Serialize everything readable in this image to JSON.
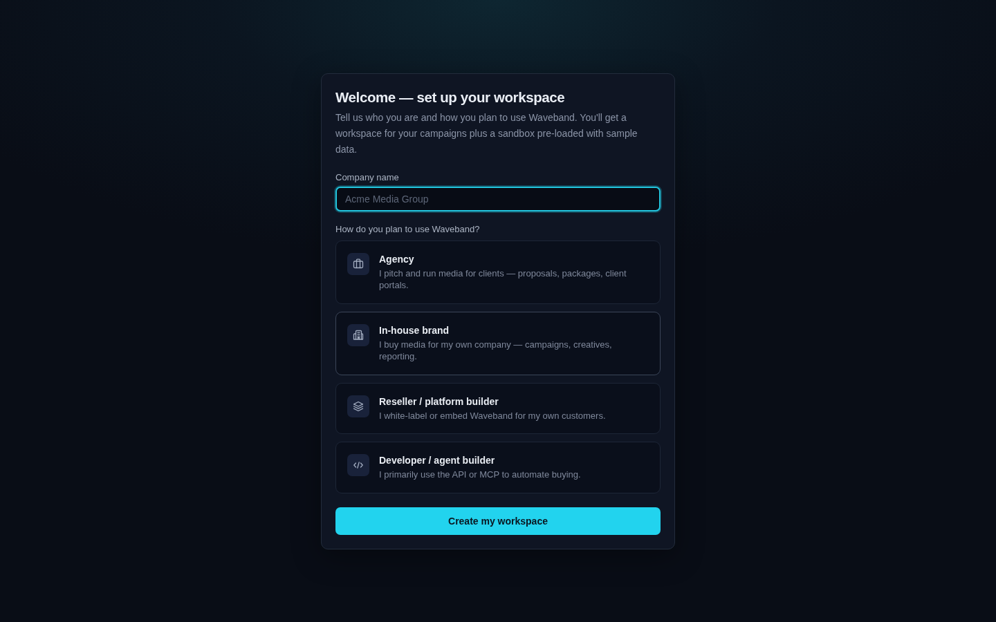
{
  "onboarding_card": {
    "title": "Welcome — set up your workspace",
    "description": "Tell us who you are and how you plan to use Waveband. You'll get a workspace for your campaigns plus a sandbox pre-loaded with sample data.",
    "company_field": {
      "label": "Company name",
      "placeholder": "Acme Media Group",
      "focused": true
    },
    "use_question": "How do you plan to use Waveband?",
    "options": [
      {
        "title": "Agency",
        "description": "I pitch and run media for clients — proposals, packages, client portals.",
        "selected": false,
        "hovered": false
      },
      {
        "title": "In-house brand",
        "description": "I buy media for my own company — campaigns, creatives, reporting.",
        "selected": false,
        "hovered": true
      },
      {
        "title": "Reseller / platform builder",
        "description": "I white-label or embed Waveband for my own customers.",
        "selected": false,
        "hovered": false
      },
      {
        "title": "Developer / agent builder",
        "description": "I primarily use the API or MCP to automate buying.",
        "selected": false,
        "hovered": false
      }
    ],
    "submit_button": "Create my workspace"
  }
}
